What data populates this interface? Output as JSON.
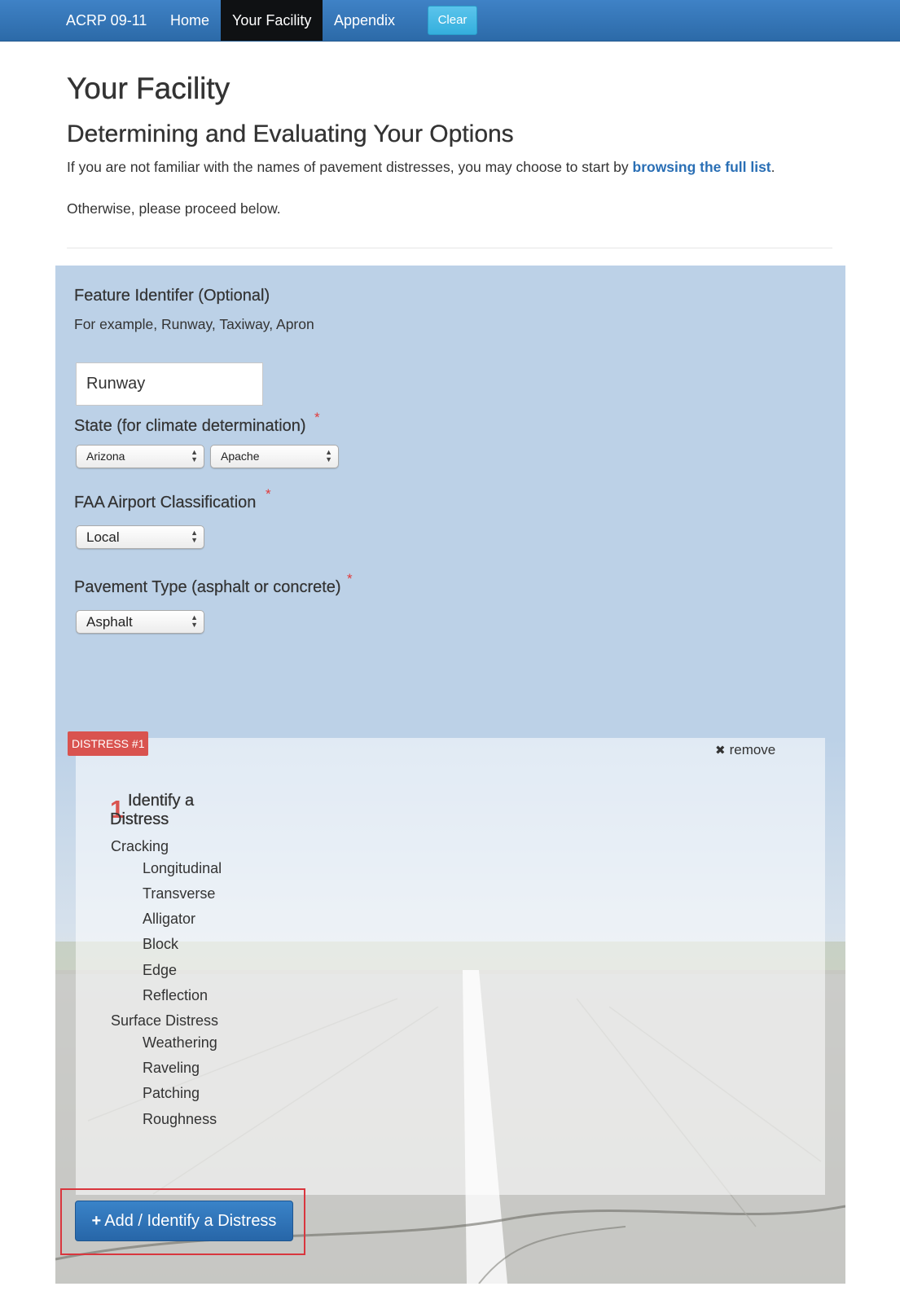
{
  "nav": {
    "brand": "ACRP 09-11",
    "items": [
      {
        "label": "Home"
      },
      {
        "label": "Your Facility"
      },
      {
        "label": "Appendix"
      }
    ],
    "clear_label": "Clear"
  },
  "page": {
    "title": "Your Facility",
    "subtitle": "Determining and Evaluating Your Options",
    "intro_before": "If you are not familiar with the names of pavement distresses, you may choose to start by ",
    "intro_link": "browsing the full list",
    "intro_after": ".",
    "proceed": "Otherwise, please proceed below."
  },
  "form": {
    "feature": {
      "label": "Feature Identifer (Optional)",
      "help": "For example, Runway, Taxiway, Apron",
      "value": "Runway"
    },
    "state": {
      "label": "State (for climate determination)",
      "required_mark": "*",
      "state_value": "Arizona",
      "county_value": "Apache"
    },
    "classification": {
      "label": "FAA Airport Classification",
      "required_mark": "*",
      "value": "Local"
    },
    "pavement": {
      "label": "Pavement Type (asphalt or concrete)",
      "required_mark": "*",
      "value": "Asphalt"
    }
  },
  "distress": {
    "badge": "DISTRESS #1",
    "remove_label": "remove",
    "step_number": "1",
    "step_title": "Identify a Distress",
    "categories": [
      {
        "name": "Cracking",
        "options": [
          "Longitudinal",
          "Transverse",
          "Alligator",
          "Block",
          "Edge",
          "Reflection"
        ]
      },
      {
        "name": "Surface Distress",
        "options": [
          "Weathering",
          "Raveling",
          "Patching",
          "Roughness"
        ]
      }
    ]
  },
  "add_button": {
    "label": "Add / Identify a Distress"
  },
  "colors": {
    "nav": "#2f74b8",
    "nav_active": "#0f1113",
    "panel": "#bcd1e7",
    "required": "#e03b3b",
    "badge": "#d9534f",
    "primary": "#2f74b8",
    "link": "#2a6fb5"
  },
  "icons": {
    "remove": "times-icon",
    "add": "plus-icon",
    "select_arrows": "updown-arrows-icon"
  }
}
